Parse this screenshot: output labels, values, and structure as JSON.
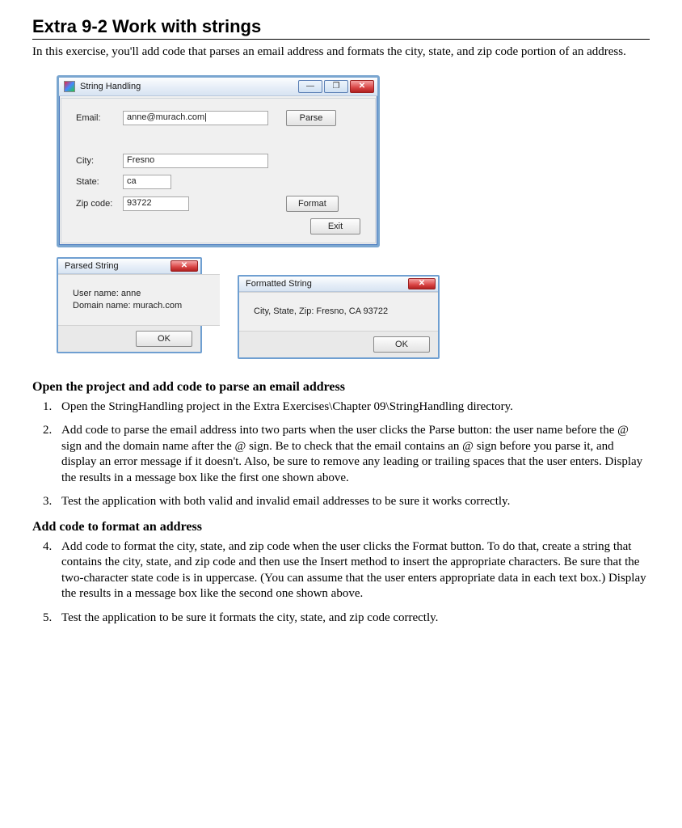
{
  "heading": "Extra 9-2    Work with strings",
  "intro": "In this exercise, you'll add code that parses an email address and formats the city, state, and zip code portion of an address.",
  "mainWindow": {
    "title": "String Handling",
    "controls": {
      "min": "—",
      "max": "❐",
      "close": "✕"
    },
    "labels": {
      "email": "Email:",
      "city": "City:",
      "state": "State:",
      "zip": "Zip code:"
    },
    "values": {
      "email": "anne@murach.com|",
      "city": "Fresno",
      "state": "ca",
      "zip": "93722"
    },
    "buttons": {
      "parse": "Parse",
      "format": "Format",
      "exit": "Exit"
    }
  },
  "parsedBox": {
    "title": "Parsed String",
    "close": "✕",
    "line1": "User name: anne",
    "line2": "Domain name: murach.com",
    "ok": "OK"
  },
  "formattedBox": {
    "title": "Formatted String",
    "close": "✕",
    "line1": "City, State, Zip: Fresno, CA 93722",
    "ok": "OK"
  },
  "section1": "Open the project and add code to parse an email address",
  "steps": {
    "s1": "Open the StringHandling project in the Extra Exercises\\Chapter 09\\StringHandling directory.",
    "s2": "Add code to parse the email address into two parts when the user clicks the Parse button: the user name before the @ sign and the domain name after the @ sign. Be to check that the email contains an @ sign before you parse it, and display an error message if it doesn't. Also, be sure to remove any leading or trailing spaces that the user enters. Display the results in a message box like the first one shown above.",
    "s3": "Test the application with both valid and invalid email addresses to be sure it works correctly.",
    "s4": "Add code to format the city, state, and zip code when the user clicks the Format button. To do that, create a string that contains the city, state, and zip code and then use the Insert method to insert the appropriate characters. Be sure that the two-character state code is in uppercase. (You can assume that the user enters appropriate data in each text box.) Display the results in a message box like the second one shown above.",
    "s5": "Test the application to be sure it formats the city, state, and zip code correctly."
  },
  "section2": "Add code to format an address"
}
